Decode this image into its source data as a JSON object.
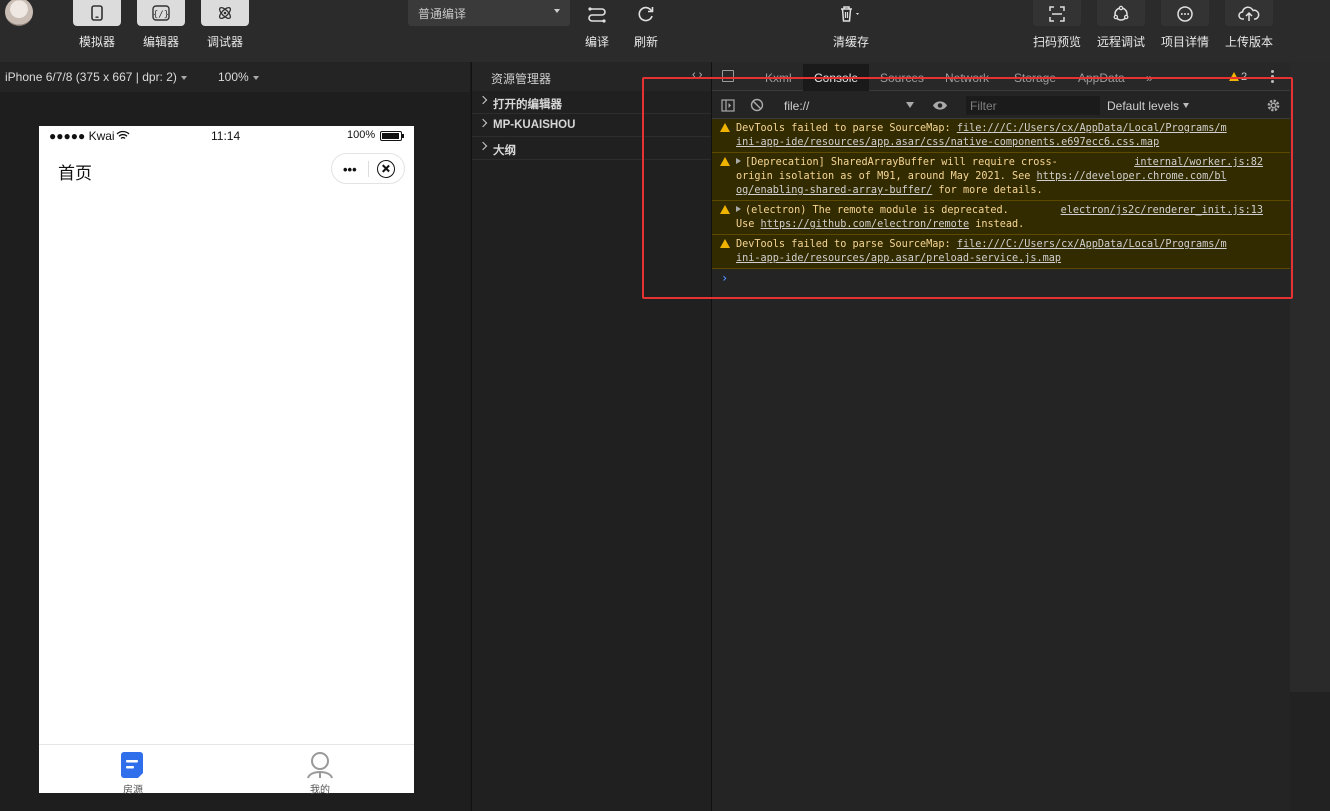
{
  "toolbar": {
    "simulator_label": "模拟器",
    "editor_label": "编辑器",
    "debugger_label": "调试器",
    "compile_mode": "普通编译",
    "compile_label": "编译",
    "refresh_label": "刷新",
    "clear_cache_label": "清缓存",
    "scan_preview_label": "扫码预览",
    "remote_debug_label": "远程调试",
    "project_details_label": "项目详情",
    "upload_label": "上传版本"
  },
  "simulator": {
    "device": "iPhone 6/7/8 (375 x 667 | dpr: 2)",
    "zoom": "100%",
    "status_carrier": "●●●●● Kwai",
    "status_time": "11:14",
    "status_battery": "100%",
    "page_title": "首页",
    "capsule_more": "•••",
    "tabs": [
      {
        "label": "房源",
        "active": true
      },
      {
        "label": "我的",
        "active": false
      }
    ]
  },
  "explorer": {
    "title": "资源管理器",
    "collapse_symbol": "‹ ›",
    "items": [
      "打开的编辑器",
      "MP-KUAISHOU",
      "大纲"
    ]
  },
  "devtools": {
    "tabs": [
      "Kxml",
      "Console",
      "Sources",
      "Network",
      "Storage",
      "AppData",
      "»"
    ],
    "active_tab": "Console",
    "warning_count": "2",
    "context": "file://",
    "filter_placeholder": "Filter",
    "levels": "Default levels",
    "messages": [
      {
        "prefix": "DevTools failed to parse SourceMap: ",
        "link": "file:///C:/Users/cx/AppData/Local/Programs/mini-app-ide/resources/app.asar/css/native-components.e697ecc6.css.map",
        "link_line1": "file:///C:/Users/cx/AppData/Local/Programs/m",
        "link_line2": "ini-app-ide/resources/app.asar/css/native-components.e697ecc6.css.map"
      },
      {
        "line1": "[Deprecation] SharedArrayBuffer will require cross-",
        "line2": "origin isolation as of M91, around May 2021. See ",
        "link_a": "https://developer.chrome.com/bl",
        "link_b": "og/enabling-shared-array-buffer/",
        "suffix": " for more details.",
        "source": "internal/worker.js:82"
      },
      {
        "line1": "(electron) The remote module is deprecated.",
        "line2_prefix": "Use ",
        "link": "https://github.com/electron/remote",
        "line2_suffix": " instead.",
        "source": "electron/js2c/renderer_init.js:13"
      },
      {
        "prefix": "DevTools failed to parse SourceMap: ",
        "link_line1": "file:///C:/Users/cx/AppData/Local/Programs/m",
        "link_line2": "ini-app-ide/resources/app.asar/preload-service.js.map"
      }
    ],
    "prompt": "›"
  },
  "colors": {
    "highlight": "#e63232",
    "warning_bg": "#332b00",
    "warning_text": "#f6d694",
    "tab_active": "#2f6fec"
  }
}
